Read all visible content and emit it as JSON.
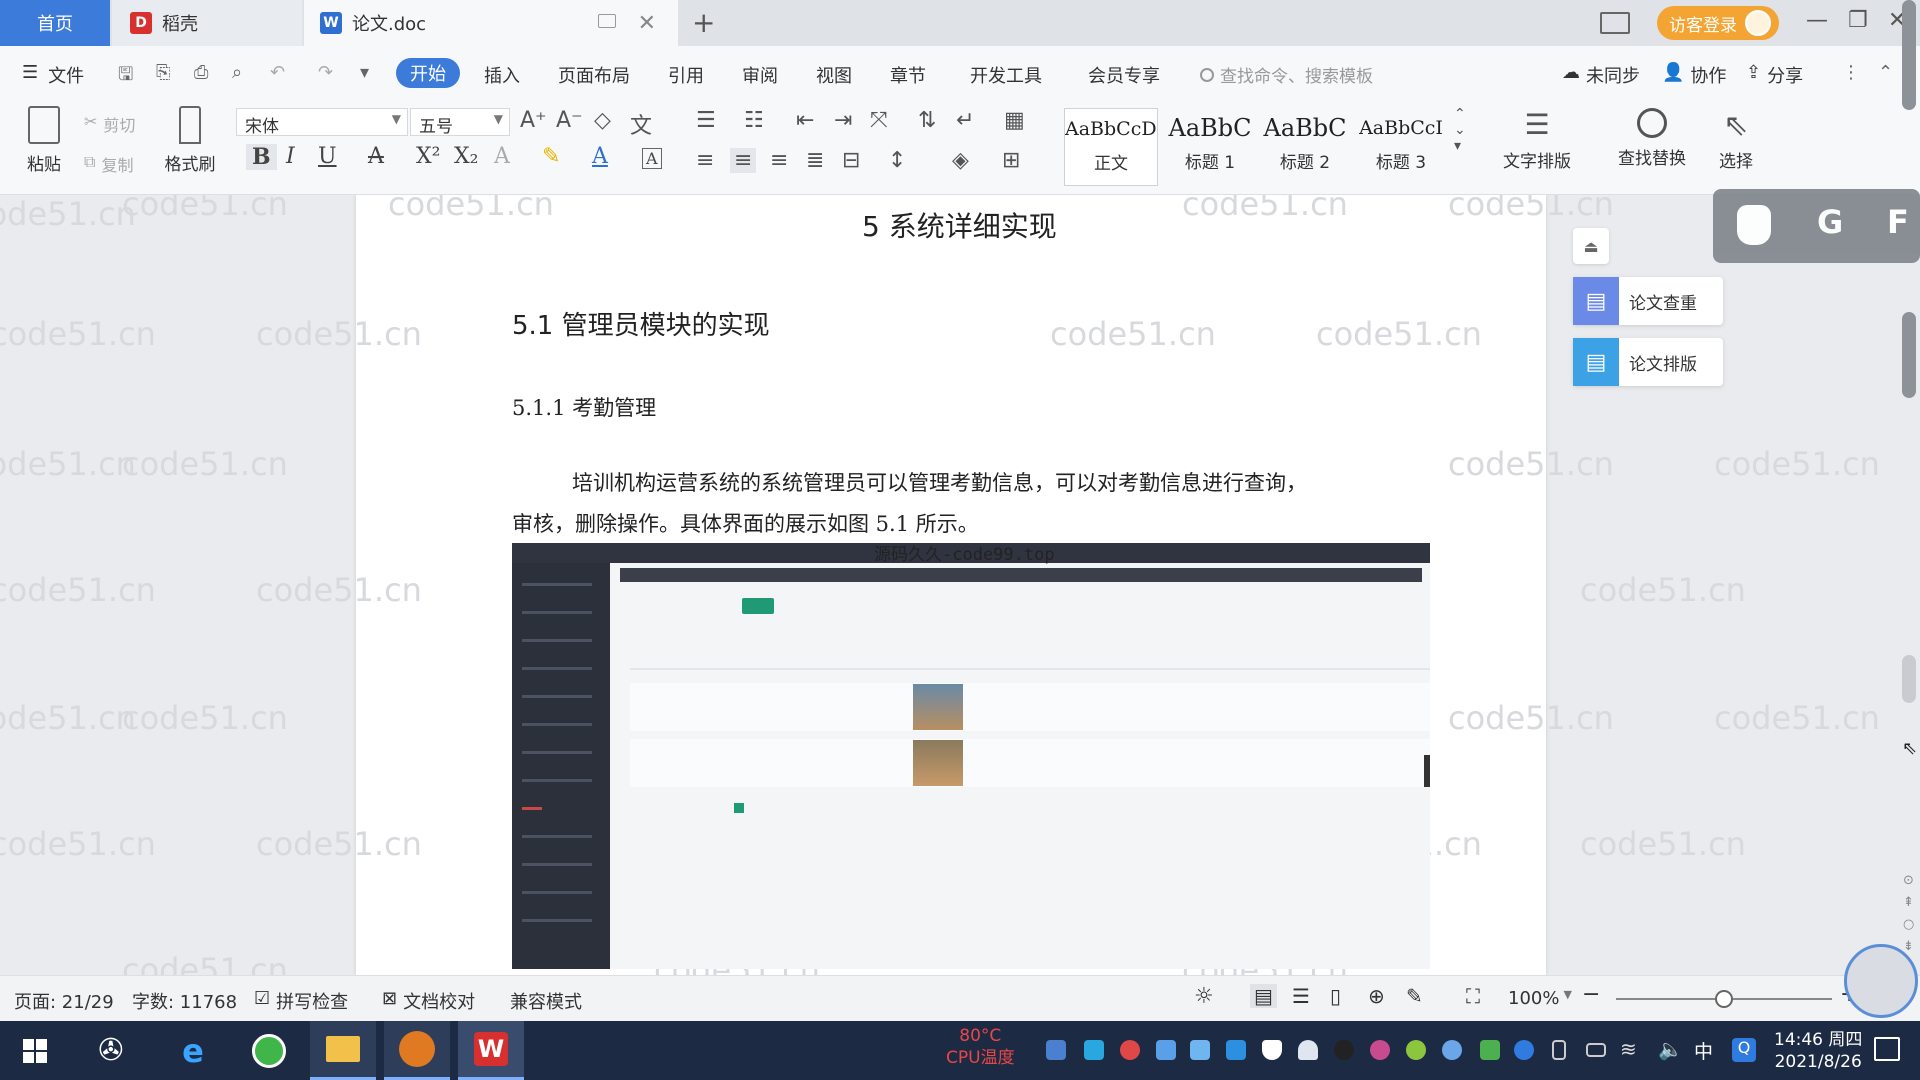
{
  "tabs": {
    "home": "首页",
    "daoke": "稻壳",
    "doc": "论文.doc",
    "login": "访客登录"
  },
  "menu": {
    "file": "文件",
    "items": [
      "开始",
      "插入",
      "页面布局",
      "引用",
      "审阅",
      "视图",
      "章节",
      "开发工具",
      "会员专享"
    ],
    "search_placeholder": "查找命令、搜索模板",
    "unsynced": "未同步",
    "collab": "协作",
    "share": "分享"
  },
  "ribbon": {
    "paste": "粘贴",
    "cut": "剪切",
    "copy": "复制",
    "format_painter": "格式刷",
    "font": "宋体",
    "size": "五号",
    "styles": [
      {
        "sample": "AaBbCcDd",
        "name": "正文"
      },
      {
        "sample": "AaBbC",
        "name": "标题 1"
      },
      {
        "sample": "AaBbC",
        "name": "标题 2"
      },
      {
        "sample": "AaBbCcI",
        "name": "标题 3"
      }
    ],
    "text_layout": "文字排版",
    "find_replace": "查找替换",
    "select": "选择"
  },
  "document": {
    "chapter_title": "5 系统详细实现",
    "section_title": "5.1  管理员模块的实现",
    "subsection_title": "5.1.1  考勤管理",
    "para_line1": "培训机构运营系统的系统管理员可以管理考勤信息，可以对考勤信息进行查询，",
    "para_line2": "审核，删除操作。具体界面的展示如图 5.1 所示。",
    "image_watermark": "源码久久-code99.top",
    "watermark_text": "code51.cn"
  },
  "side_panel": {
    "paper_check": "论文查重",
    "paper_layout": "论文排版"
  },
  "status": {
    "page": "页面: 21/29",
    "words": "字数: 11768",
    "spell": "拼写检查",
    "proof": "文档校对",
    "compat": "兼容模式",
    "zoom": "100%",
    "zoom_level": 0.5
  },
  "taskbar": {
    "temp": "80°C",
    "cpu": "CPU温度",
    "time": "14:46 周四",
    "date": "2021/8/26",
    "ime": "中"
  },
  "colors": {
    "accent": "#3c7bd9",
    "login": "#f4a433",
    "taskbar": "#1c2a44",
    "wps_red": "#d8302f"
  }
}
